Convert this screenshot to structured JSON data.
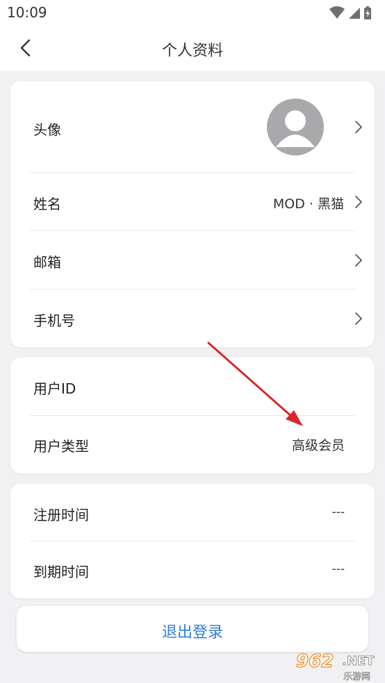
{
  "status_bar": {
    "time": "10:09"
  },
  "nav": {
    "title": "个人资料"
  },
  "profile_card": {
    "avatar_label": "头像",
    "name_label": "姓名",
    "name_value": "MOD · 黑猫",
    "email_label": "邮箱",
    "phone_label": "手机号"
  },
  "user_card": {
    "id_label": "用户ID",
    "type_label": "用户类型",
    "type_value": "高级会员"
  },
  "time_card": {
    "register_label": "注册时间",
    "register_value": "---",
    "expire_label": "到期时间",
    "expire_value": "---"
  },
  "logout": {
    "label": "退出登录"
  },
  "watermark": {
    "number": "962",
    "suffix": ".NET",
    "cn": "乐游网"
  },
  "colors": {
    "accent": "#2f7fd0",
    "background": "#f1f1f3",
    "annotation_arrow": "#d9262b",
    "watermark": "#f08a1a"
  }
}
